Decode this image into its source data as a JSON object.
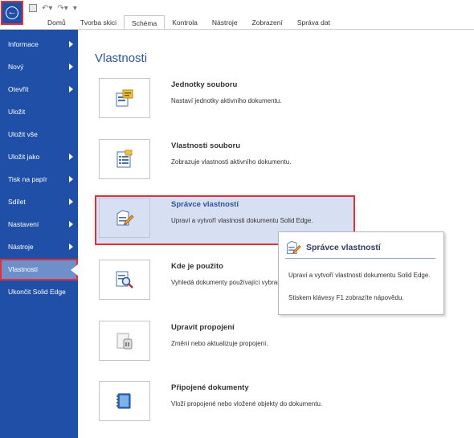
{
  "ribbon": {
    "tabs": [
      "Domů",
      "Tvorba skici",
      "Schéma",
      "Kontrola",
      "Nástroje",
      "Zobrazení",
      "Správa dat"
    ],
    "active_tab": "Schéma"
  },
  "sidebar": {
    "items": [
      {
        "label": "Informace",
        "arrow": true
      },
      {
        "label": "Nový",
        "arrow": true
      },
      {
        "label": "Otevřít",
        "arrow": true
      },
      {
        "label": "Uložit",
        "arrow": false
      },
      {
        "label": "Uložit vše",
        "arrow": false
      },
      {
        "label": "Uložit jako",
        "arrow": true
      },
      {
        "label": "Tisk na papír",
        "arrow": true
      },
      {
        "label": "Sdílet",
        "arrow": true
      },
      {
        "label": "Nastavení",
        "arrow": true
      },
      {
        "label": "Nástroje",
        "arrow": true
      },
      {
        "label": "Vlastnosti",
        "arrow": false,
        "selected": true
      },
      {
        "label": "Ukončit Solid Edge",
        "arrow": false
      }
    ]
  },
  "main": {
    "title": "Vlastnosti",
    "commands": [
      {
        "title": "Jednotky souboru",
        "description": "Nastaví jednotky aktivního dokumentu.",
        "icon": "units-icon"
      },
      {
        "title": "Vlastnosti souboru",
        "description": "Zobrazuje vlastnosti aktivního dokumentu.",
        "icon": "file-properties-icon"
      },
      {
        "title": "Správce vlastností",
        "description": "Upraví a vytvoří vlastnosti dokumentu Solid Edge.",
        "icon": "property-manager-icon",
        "highlighted": true
      },
      {
        "title": "Kde je použito",
        "description": "Vyhledá dokumenty používající vybraný",
        "icon": "where-used-icon"
      },
      {
        "title": "Upravit propojení",
        "description": "Změní nebo aktualizuje propojení.",
        "icon": "edit-links-icon"
      },
      {
        "title": "Připojené dokumenty",
        "description": "Vloží propojené nebo vložené objekty do dokumentu.",
        "icon": "attached-documents-icon"
      }
    ]
  },
  "tooltip": {
    "title": "Správce vlastností",
    "body": "Upraví a vytvoří vlastnosti dokumentu Solid Edge.",
    "help": "Stiskem klávesy F1 zobrazíte nápovědu."
  },
  "colors": {
    "sidebar": "#1f4fa6",
    "sidebar_selected": "#6f8fca",
    "highlight": "#d6e0f2",
    "red_frame": "#e0313b",
    "title_blue": "#2f5597"
  }
}
